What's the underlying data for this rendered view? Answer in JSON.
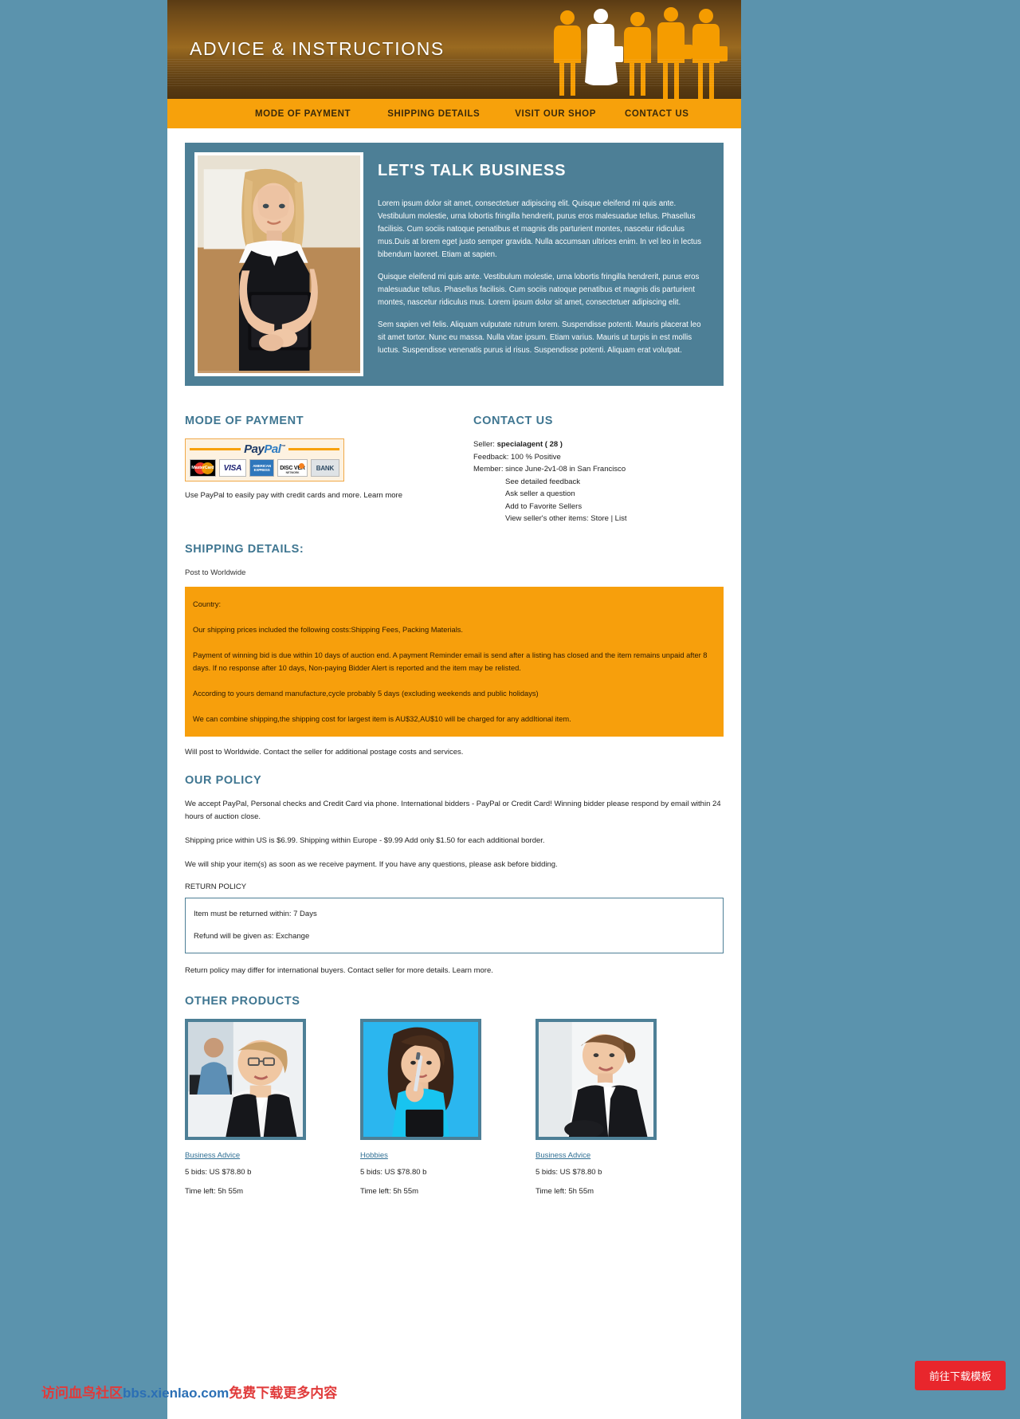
{
  "banner": {
    "title": "ADVICE & INSTRUCTIONS"
  },
  "nav": {
    "items": [
      {
        "label": "MODE OF PAYMENT"
      },
      {
        "label": "SHIPPING DETAILS"
      },
      {
        "label": "VISIT OUR SHOP"
      },
      {
        "label": "CONTACT US"
      }
    ]
  },
  "hero": {
    "heading": "LET'S TALK BUSINESS",
    "paragraphs": [
      "Lorem ipsum dolor sit amet, consectetuer adipiscing elit. Quisque eleifend mi quis ante. Vestibulum molestie, urna lobortis fringilla hendrerit, purus eros malesuadue tellus. Phasellus facilisis. Cum sociis natoque penatibus et magnis dis parturient montes, nascetur ridiculus mus.Duis at lorem eget justo semper gravida. Nulla accumsan ultrices enim. In vel leo in lectus bibendum laoreet. Etiam at sapien.",
      "Quisque eleifend mi quis ante. Vestibulum molestie, urna lobortis fringilla hendrerit, purus eros malesuadue tellus. Phasellus facilisis. Cum sociis natoque penatibus et magnis dis parturient montes, nascetur ridiculus mus. Lorem ipsum dolor sit amet, consectetuer adipiscing elit.",
      "Sem sapien vel felis. Aliquam vulputate rutrum lorem. Suspendisse potenti. Mauris placerat leo sit amet tortor. Nunc eu massa. Nulla vitae ipsum. Etiam varius. Mauris ut turpis in est mollis luctus. Suspendisse venenatis purus id risus. Suspendisse potenti. Aliquam erat volutpat."
    ]
  },
  "payment": {
    "heading": "MODE OF PAYMENT",
    "badge": {
      "logo_pay": "Pay",
      "logo_pal": "Pal",
      "trademark": "™",
      "cards": [
        {
          "name": "MasterCard",
          "label": "MasterCard"
        },
        {
          "name": "Visa",
          "label": "VISA"
        },
        {
          "name": "American Express",
          "label": "AMERICAN EXPRESS"
        },
        {
          "name": "Discover",
          "label": "DISC VER",
          "sub": "NETWORK"
        },
        {
          "name": "Bank",
          "label": "BANK"
        }
      ]
    },
    "note": "Use PayPal to easily pay with credit cards and more. Learn more"
  },
  "contact": {
    "heading": "CONTACT US",
    "seller_label": "Seller:",
    "seller_value": "specialagent ( 28 )",
    "feedback": "Feedback: 100 % Positive",
    "member": "Member: since June-2v1-08 in San Francisco",
    "links": [
      "See detailed feedback",
      "Ask seller a question",
      "Add to Favorite Sellers",
      "View seller's other items: Store | List"
    ]
  },
  "shipping": {
    "heading": "SHIPPING DETAILS:",
    "post_to": "Post to Worldwide",
    "box": [
      "Country:",
      "Our shipping prices included the following costs:Shipping Fees, Packing Materials.",
      "Payment of winning bid is due within 10 days of auction end. A payment Reminder email is send after a listing has closed and the item remains unpaid after 8 days. If no response after 10 days, Non-paying Bidder Alert is reported and the item may be relisted.",
      "According to yours demand manufacture,cycle probably 5 days (excluding weekends and public holidays)",
      "We can combine shipping,the shipping cost for largest item is AU$32,AU$10 will be charged for any addItional item."
    ],
    "after": "Will post to Worldwide. Contact the seller for additional postage costs and services."
  },
  "policy": {
    "heading": "OUR POLICY",
    "paragraphs": [
      "We accept PayPal, Personal checks and Credit Card via phone. International bidders - PayPal or Credit Card! Winning bidder please respond by email within 24 hours of auction close.",
      "Shipping price within US is $6.99. Shipping within Europe - $9.99 Add only $1.50 for each additional border.",
      "We will ship your item(s) as soon as we receive payment. If you have any questions, please ask before bidding."
    ],
    "return_label": "RETURN POLICY",
    "return_box": [
      "Item must be returned within: 7 Days",
      "Refund will be given as: Exchange"
    ],
    "footnote": "Return policy may differ for international buyers. Contact seller for more details. Learn more."
  },
  "other_products": {
    "heading": "OTHER PRODUCTS",
    "items": [
      {
        "title": "Business Advice",
        "bids": "5 bids: US $78.80 b",
        "time": "Time left: 5h 55m"
      },
      {
        "title": "Hobbies",
        "bids": "5 bids: US $78.80 b",
        "time": "Time left: 5h 55m"
      },
      {
        "title": "Business Advice",
        "bids": "5 bids: US $78.80 b",
        "time": "Time left: 5h 55m"
      }
    ]
  },
  "footer": {
    "watermark_a": "访问血鸟社区",
    "watermark_b": "bbs.xienlao.com",
    "watermark_c": "免费下载更多内容",
    "download_button": "前往下载模板"
  },
  "colors": {
    "page_bg": "#5b93ad",
    "nav_orange": "#f7a10b",
    "hero_blue": "#4d7f96",
    "heading_blue": "#3f7691",
    "ship_orange": "#f79f0c",
    "button_red": "#e8262c"
  }
}
